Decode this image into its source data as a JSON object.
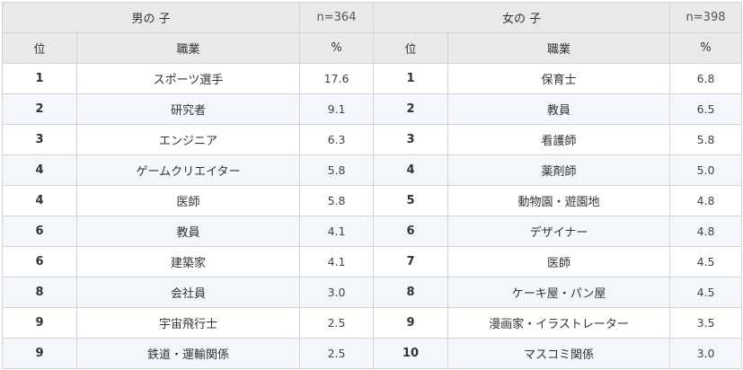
{
  "boys": {
    "title": "男の 子",
    "n": "n=364"
  },
  "girls": {
    "title": "女の 子",
    "n": "n=398"
  },
  "columns": {
    "rank": "位",
    "job": "職業",
    "pct": "%"
  },
  "rows": [
    {
      "boy_rank": "1",
      "boy_job": "スポーツ選手",
      "boy_pct": "17.6",
      "girl_rank": "1",
      "girl_job": "保育士",
      "girl_pct": "6.8"
    },
    {
      "boy_rank": "2",
      "boy_job": "研究者",
      "boy_pct": "9.1",
      "girl_rank": "2",
      "girl_job": "教員",
      "girl_pct": "6.5"
    },
    {
      "boy_rank": "3",
      "boy_job": "エンジニア",
      "boy_pct": "6.3",
      "girl_rank": "3",
      "girl_job": "看護師",
      "girl_pct": "5.8"
    },
    {
      "boy_rank": "4",
      "boy_job": "ゲームクリエイター",
      "boy_pct": "5.8",
      "girl_rank": "4",
      "girl_job": "薬剤師",
      "girl_pct": "5.0"
    },
    {
      "boy_rank": "4",
      "boy_job": "医師",
      "boy_pct": "5.8",
      "girl_rank": "5",
      "girl_job": "動物園・遊園地",
      "girl_pct": "4.8"
    },
    {
      "boy_rank": "6",
      "boy_job": "教員",
      "boy_pct": "4.1",
      "girl_rank": "6",
      "girl_job": "デザイナー",
      "girl_pct": "4.8"
    },
    {
      "boy_rank": "6",
      "boy_job": "建築家",
      "boy_pct": "4.1",
      "girl_rank": "7",
      "girl_job": "医師",
      "girl_pct": "4.5"
    },
    {
      "boy_rank": "8",
      "boy_job": "会社員",
      "boy_pct": "3.0",
      "girl_rank": "8",
      "girl_job": "ケーキ屋・パン屋",
      "girl_pct": "4.5"
    },
    {
      "boy_rank": "9",
      "boy_job": "宇宙飛行士",
      "boy_pct": "2.5",
      "girl_rank": "9",
      "girl_job": "漫画家・イラストレーター",
      "girl_pct": "3.5"
    },
    {
      "boy_rank": "9",
      "boy_job": "鉄道・運輸関係",
      "boy_pct": "2.5",
      "girl_rank": "10",
      "girl_job": "マスコミ関係",
      "girl_pct": "3.0"
    }
  ]
}
